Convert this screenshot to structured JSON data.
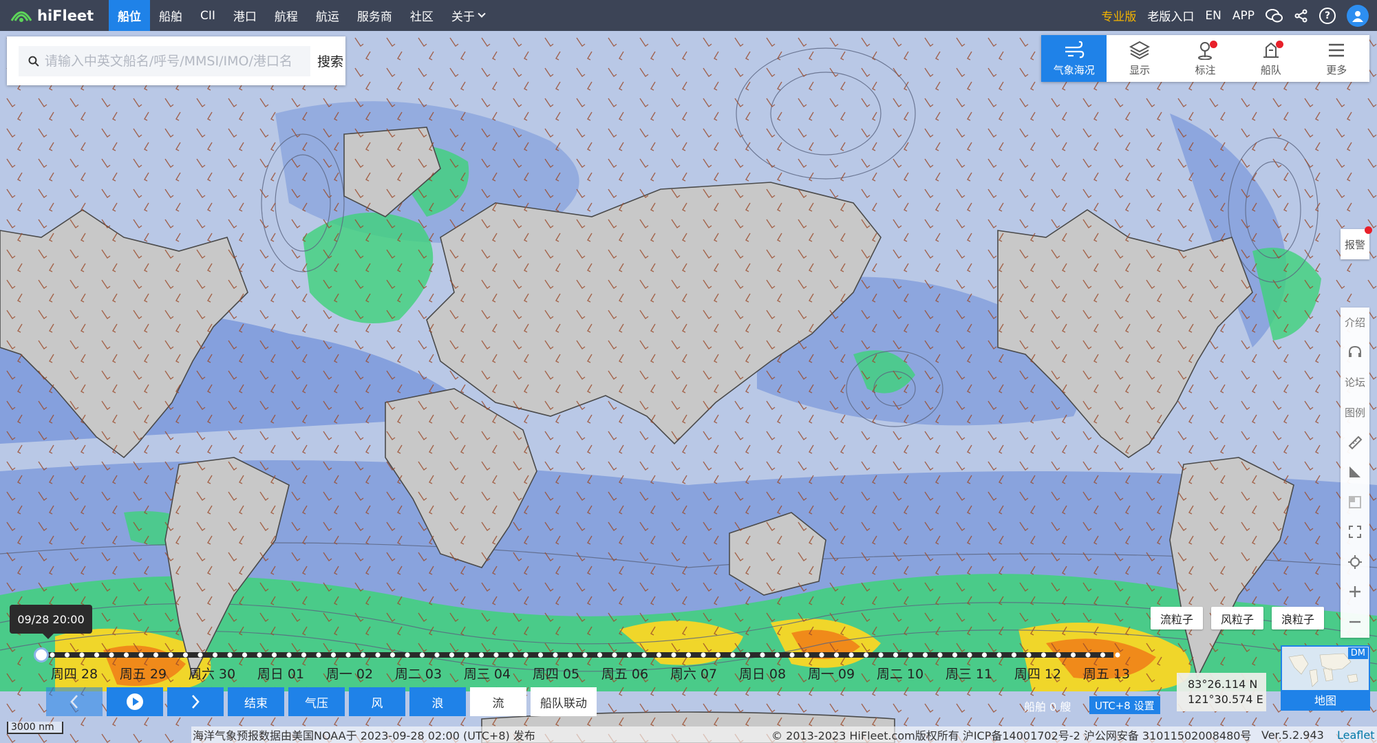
{
  "brand": {
    "name": "hiFleet"
  },
  "nav": {
    "items": [
      {
        "label": "船位",
        "active": true
      },
      {
        "label": "船舶"
      },
      {
        "label": "CII"
      },
      {
        "label": "港口"
      },
      {
        "label": "航程"
      },
      {
        "label": "航运"
      },
      {
        "label": "服务商"
      },
      {
        "label": "社区"
      },
      {
        "label": "关于"
      }
    ],
    "right": {
      "pro": "专业版",
      "old": "老版入口",
      "lang": "EN",
      "app": "APP"
    }
  },
  "search": {
    "placeholder": "请输入中英文船名/呼号/MMSI/IMO/港口名",
    "button": "搜索"
  },
  "tools": [
    {
      "label": "气象海况",
      "icon": "weather-icon",
      "active": true
    },
    {
      "label": "显示",
      "icon": "layers-icon"
    },
    {
      "label": "标注",
      "icon": "marker-icon",
      "dot": true
    },
    {
      "label": "船队",
      "icon": "fleet-icon",
      "dot": true
    },
    {
      "label": "更多",
      "icon": "menu-icon"
    }
  ],
  "sidebar": {
    "alarm": "报警",
    "items": [
      "介绍",
      "论坛",
      "图例"
    ]
  },
  "particles": [
    "流粒子",
    "风粒子",
    "浪粒子"
  ],
  "timeline": {
    "current": "09/28 20:00",
    "days": [
      "周四 28",
      "周五 29",
      "周六 30",
      "周日 01",
      "周一 02",
      "周二 03",
      "周三 04",
      "周四 05",
      "周五 06",
      "周六 07",
      "周日 08",
      "周一 09",
      "周二 10",
      "周三 11",
      "周四 12",
      "周五 13"
    ]
  },
  "controls": {
    "end": "结束",
    "pressure": "气压",
    "wind": "风",
    "wave": "浪",
    "current": "流",
    "fleet_link": "船队联动"
  },
  "status": {
    "ships": "船舶 0 艘",
    "utc": "UTC+8 设置",
    "lat": "83°26.114 N",
    "lon": "121°30.574 E",
    "dm": "DM",
    "minimap": "地图",
    "scale": "3000 nm"
  },
  "footer": {
    "noaa": "海洋气象预报数据由美国NOAA于 2023-09-28 02:00 (UTC+8) 发布",
    "copyright": "© 2013-2023 HiFleet.com版权所有 沪ICP备14001702号-2 沪公网安备 31011502008480号",
    "version": "Ver.5.2.943",
    "leaflet": "Leaflet"
  },
  "colors": {
    "nav_bg": "#3c4456",
    "accent": "#1f82e8",
    "pro": "#f4b400",
    "land": "#c8c8c8",
    "ocean": "#b9c8e6"
  }
}
